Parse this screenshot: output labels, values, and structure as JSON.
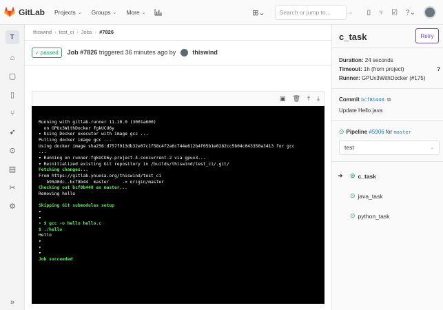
{
  "topbar": {
    "brand": "GitLab",
    "nav": [
      {
        "label": "Projects"
      },
      {
        "label": "Groups"
      },
      {
        "label": "More"
      }
    ],
    "search_placeholder": "Search or jump to..."
  },
  "sidebar": {
    "avatar_letter": "T",
    "items": [
      "home-icon",
      "file-icon",
      "merge-icon",
      "repo-icon",
      "rocket-icon",
      "deploy-icon",
      "clipboard-icon",
      "scissors-icon",
      "gear-icon"
    ]
  },
  "breadcrumb": {
    "items": [
      "thiswind",
      "test_ci",
      "Jobs"
    ],
    "current": "#7826"
  },
  "job": {
    "status": "passed",
    "number": "Job #7826",
    "triggered_text": "triggered 36 minutes ago by",
    "user": "thiswind"
  },
  "log": {
    "lines": [
      {
        "text": "Running with gitlab-runner 11.10.0 (3001a600)",
        "green": false
      },
      {
        "text": "  on GPUx3WithDocker fgkUCU6y",
        "green": false
      },
      {
        "text": "▾ Using Docker executor with image gcc ...",
        "green": false
      },
      {
        "text": "Pulling docker image gcc ...",
        "green": false
      },
      {
        "text": "Using docker image sha256:d757f913db32e07c1f58c4f2a6c744e612b4f05b1e0282cc5b04c043350a3413 for gcc",
        "green": false
      },
      {
        "text": "...",
        "green": false
      },
      {
        "text": "▾ Running on runner-fgkUCU6y-project-4-concurrent-2 via gpux3...",
        "green": false
      },
      {
        "text": "▾ Reinitialized existing Git repository in /builds/thiswind/test_ci/.git/",
        "green": false
      },
      {
        "text": "Fetching changes...",
        "green": true
      },
      {
        "text": "From https://gitlab.ynuosa.org/thiswind/test_ci",
        "green": false
      },
      {
        "text": "   b9540dc..bcf8b44  master     -> origin/master",
        "green": false
      },
      {
        "text": "Checking out bcf8b440 as master...",
        "green": true
      },
      {
        "text": "Removing hello",
        "green": false
      },
      {
        "text": "",
        "green": false
      },
      {
        "text": "Skipping Git submodules setup",
        "green": true
      },
      {
        "text": "▾",
        "green": false
      },
      {
        "text": "▾",
        "green": false
      },
      {
        "text": "▾ $ gcc -o hello hello.c",
        "green": true
      },
      {
        "text": "$ ./hello",
        "green": true
      },
      {
        "text": "Hello",
        "green": false
      },
      {
        "text": "▾",
        "green": false
      },
      {
        "text": "▾",
        "green": false
      },
      {
        "text": "▾",
        "green": false
      },
      {
        "text": "Job succeeded",
        "green": true
      }
    ]
  },
  "rightbar": {
    "title": "c_task",
    "retry": "Retry",
    "duration_label": "Duration:",
    "duration_value": "24 seconds",
    "timeout_label": "Timeout:",
    "timeout_value": "1h (from project)",
    "runner_label": "Runner:",
    "runner_value": "GPUx3WithDocker (#175)",
    "commit_label": "Commit",
    "commit_sha": "bcf8b440",
    "commit_message": "Update Hello.java",
    "pipeline_label": "Pipeline",
    "pipeline_id": "#5906",
    "pipeline_for": "for",
    "pipeline_branch": "master",
    "stage_selected": "test",
    "jobs": [
      {
        "name": "c_task",
        "current": true
      },
      {
        "name": "java_task",
        "current": false
      },
      {
        "name": "python_task",
        "current": false
      }
    ]
  },
  "colors": {
    "success": "#1aaa55",
    "accent": "#6b4fbb",
    "link": "#1f78d1",
    "terminal_bg": "#000000",
    "terminal_green": "#4df74d"
  }
}
